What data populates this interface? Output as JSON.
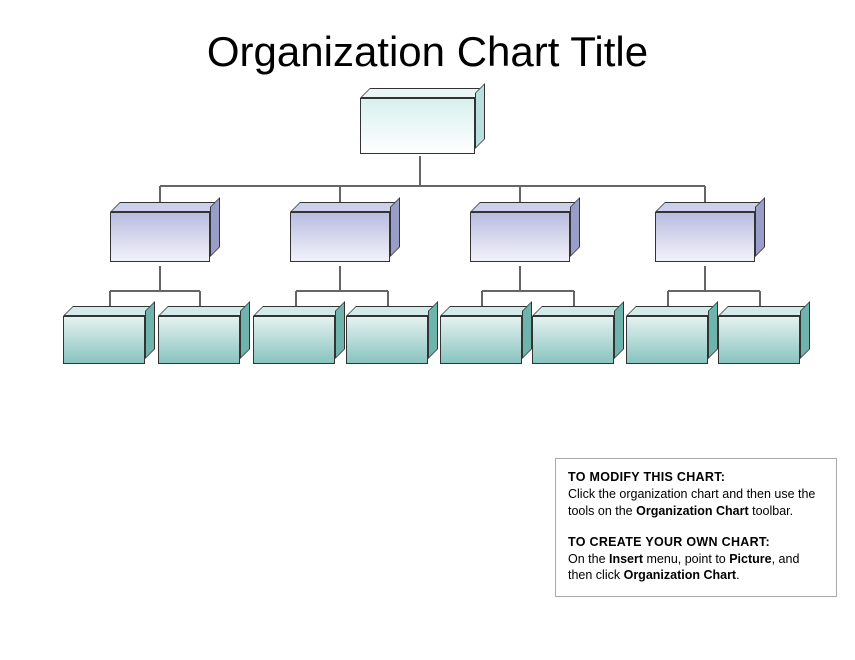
{
  "title": "Organization Chart Title",
  "chart": {
    "level1": {
      "label": ""
    },
    "level2": [
      {
        "label": ""
      },
      {
        "label": ""
      },
      {
        "label": ""
      },
      {
        "label": ""
      }
    ],
    "level3": [
      {
        "label": ""
      },
      {
        "label": ""
      },
      {
        "label": ""
      },
      {
        "label": ""
      },
      {
        "label": ""
      },
      {
        "label": ""
      },
      {
        "label": ""
      },
      {
        "label": ""
      }
    ]
  },
  "help": {
    "modify_heading": "TO MODIFY  THIS CHART:",
    "modify_line1": "Click the organization chart and then use the tools on the ",
    "modify_bold1": "Organization Chart",
    "modify_line2": " toolbar.",
    "create_heading": "TO CREATE  YOUR OWN CHART:",
    "create_line1": "On the ",
    "create_bold1": "Insert",
    "create_line2": " menu, point to ",
    "create_bold2": "Picture",
    "create_line3": ", and then click ",
    "create_bold3": "Organization Chart",
    "create_line4": "."
  }
}
